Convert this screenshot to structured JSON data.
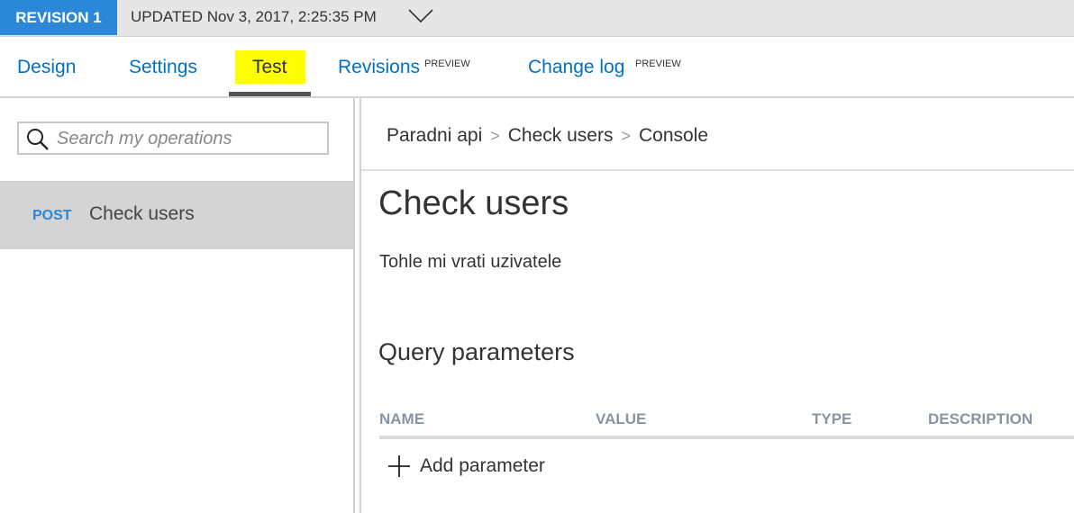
{
  "revision_bar": {
    "badge": "REVISION 1",
    "updated": "UPDATED Nov 3, 2017, 2:25:35 PM",
    "dropdown_icon": "chevron-down-icon"
  },
  "tabs": [
    {
      "label": "Design",
      "badge": "",
      "active": false
    },
    {
      "label": "Settings",
      "badge": "",
      "active": false
    },
    {
      "label": "Test",
      "badge": "",
      "active": true,
      "highlight": "#ffff00"
    },
    {
      "label": "Revisions",
      "badge": "PREVIEW",
      "active": false
    },
    {
      "label": "Change log",
      "badge": "PREVIEW",
      "active": false
    }
  ],
  "sidebar": {
    "search_placeholder": "Search my operations",
    "operations": [
      {
        "method": "POST",
        "name": "Check users",
        "selected": true
      }
    ]
  },
  "breadcrumb": [
    "Paradni api",
    "Check users",
    "Console"
  ],
  "breadcrumb_separator": ">",
  "main": {
    "title": "Check users",
    "description": "Tohle mi vrati uzivatele",
    "query_parameters": {
      "heading": "Query parameters",
      "columns": [
        "NAME",
        "VALUE",
        "TYPE",
        "DESCRIPTION"
      ],
      "add_label": "Add parameter"
    }
  },
  "colors": {
    "accent": "#2b88d8",
    "link": "#0072c6",
    "selected_row": "#d4d4d4"
  }
}
